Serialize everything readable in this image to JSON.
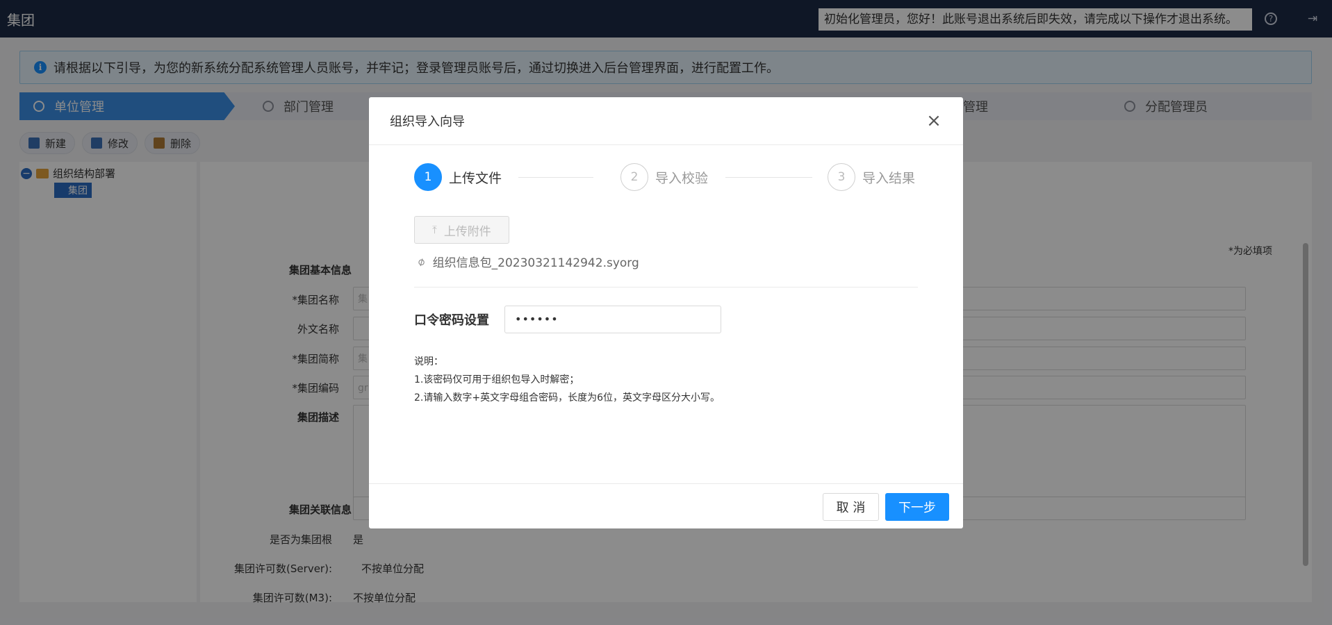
{
  "header": {
    "title": "集团",
    "notice": "初始化管理员，您好！此账号退出系统后即失效，请完成以下操作才退出系统。",
    "help_icon": "?",
    "logout_icon": "⇥"
  },
  "infobar": {
    "text": "请根据以下引导，为您的新系统分配系统管理人员账号，并牢记；登录管理员账号后，通过切换进入后台管理界面，进行配置工作。"
  },
  "steps": [
    {
      "label": "单位管理"
    },
    {
      "label": "部门管理"
    },
    {
      "label": "管理"
    },
    {
      "label": "分配管理员"
    }
  ],
  "toolbar": {
    "new_label": "新建",
    "edit_label": "修改",
    "delete_label": "删除"
  },
  "tree": {
    "root_label": "组织结构部署",
    "child_label": "集团"
  },
  "form": {
    "required_note": "*为必填项",
    "basic_section": "集团基本信息",
    "name_label": "*集团名称",
    "name_value": "集",
    "foreign_label": "外文名称",
    "short_label": "*集团简称",
    "short_value": "集",
    "code_label": "*集团编码",
    "code_value": "gr",
    "desc_label": "集团描述",
    "related_section": "集团关联信息",
    "is_root_label": "是否为集团根",
    "is_root_value": "是",
    "server_label": "集团许可数(Server):",
    "server_value": "不按单位分配",
    "m3_label": "集团许可数(M3):",
    "m3_value": "不按单位分配"
  },
  "modal": {
    "title": "组织导入向导",
    "close_icon": "×",
    "steps": [
      {
        "num": "1",
        "label": "上传文件"
      },
      {
        "num": "2",
        "label": "导入校验"
      },
      {
        "num": "3",
        "label": "导入结果"
      }
    ],
    "upload_label": "上传附件",
    "upload_icon": "⤒",
    "file_icon": "⌀",
    "file_name": "组织信息包_20230321142942.syorg",
    "password_label": "口令密码设置",
    "password_value": "••••••",
    "explain_title": "说明：",
    "explain_1": "1.该密码仅可用于组织包导入时解密；",
    "explain_2": "2.请输入数字+英文字母组合密码，长度为6位，英文字母区分大小写。",
    "cancel_label": "取 消",
    "next_label": "下一步"
  }
}
